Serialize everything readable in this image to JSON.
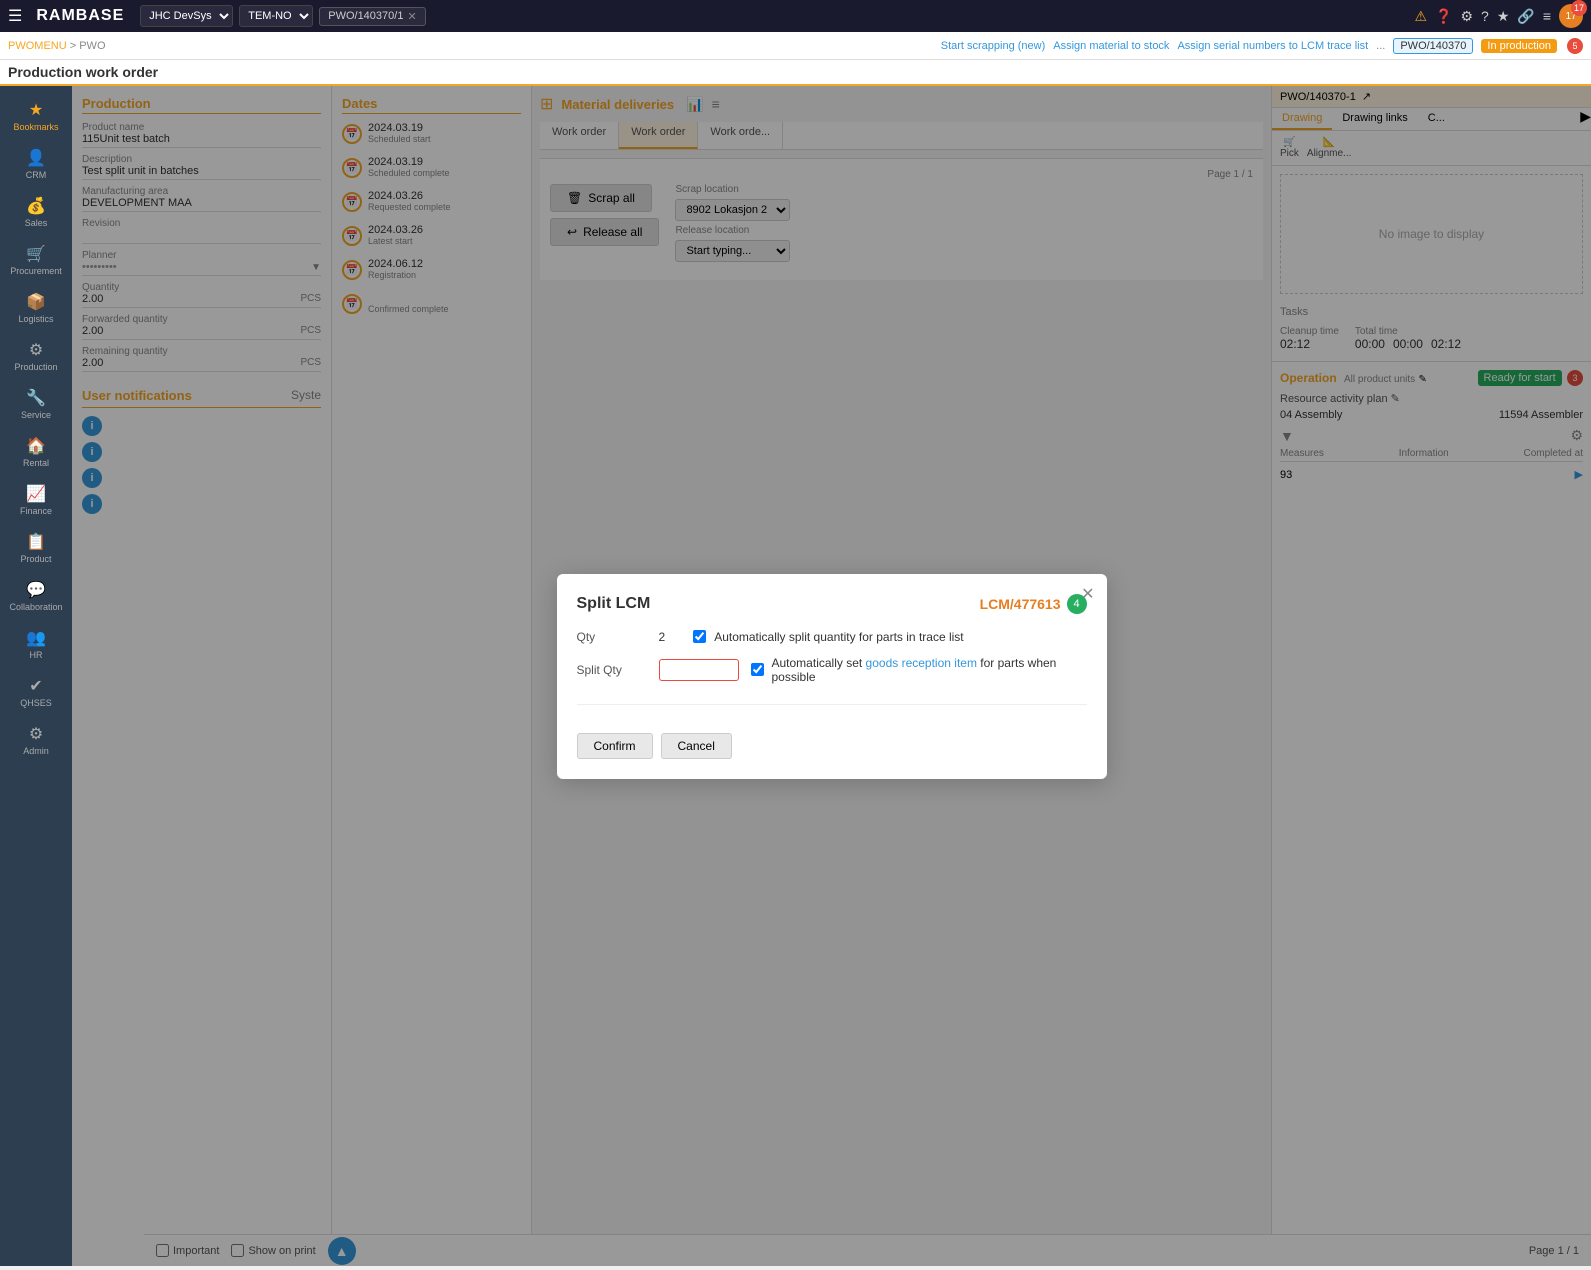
{
  "app": {
    "logo": "RAMBASE"
  },
  "topbar": {
    "hamburger": "☰",
    "company": "JHC DevSys",
    "env": "TEM-NO",
    "pwo_id": "PWO/140370/1",
    "alert_icon": "⚠",
    "help_icons": [
      "?",
      "★",
      "🔗",
      "≡"
    ],
    "user_number": "17"
  },
  "secondbar": {
    "breadcrumb_parent": "PWOMENU",
    "breadcrumb_separator": " > ",
    "breadcrumb_current": "PWO",
    "actions": {
      "start_scrapping": "Start scrapping (new)",
      "assign_material": "Assign material to stock",
      "assign_serial": "Assign serial numbers to LCM trace list",
      "more": "..."
    },
    "pwo_ref": "PWO/140370",
    "status": "In production",
    "status_count": "5"
  },
  "page_header": {
    "title": "Production work order"
  },
  "sidebar": {
    "items": [
      {
        "id": "bookmarks",
        "label": "Bookmarks",
        "icon": "★",
        "active": true
      },
      {
        "id": "crm",
        "label": "CRM",
        "icon": "👤"
      },
      {
        "id": "sales",
        "label": "Sales",
        "icon": "💰"
      },
      {
        "id": "procurement",
        "label": "Procurement",
        "icon": "🛒"
      },
      {
        "id": "logistics",
        "label": "Logistics",
        "icon": "📦"
      },
      {
        "id": "production",
        "label": "Production",
        "icon": "⚙"
      },
      {
        "id": "service",
        "label": "Service",
        "icon": "🔧"
      },
      {
        "id": "rental",
        "label": "Rental",
        "icon": "🏠"
      },
      {
        "id": "finance",
        "label": "Finance",
        "icon": "📈"
      },
      {
        "id": "product",
        "label": "Product",
        "icon": "📋"
      },
      {
        "id": "collaboration",
        "label": "Collaboration",
        "icon": "💬"
      },
      {
        "id": "hr",
        "label": "HR",
        "icon": "👥"
      },
      {
        "id": "qhses",
        "label": "QHSES",
        "icon": "✔"
      },
      {
        "id": "admin",
        "label": "Admin",
        "icon": "⚙"
      }
    ]
  },
  "production_section": {
    "title": "Production",
    "fields": {
      "product_name_label": "Product name",
      "product_name_value": "115Unit test batch",
      "description_label": "Description",
      "description_value": "Test split unit in batches",
      "manufacturing_area_label": "Manufacturing area",
      "manufacturing_area_value": "DEVELOPMENT MAA",
      "revision_label": "Revision",
      "revision_value": "",
      "planner_label": "Planner",
      "planner_value": "••• •••••",
      "quantity_label": "Quantity",
      "quantity_value": "2.00",
      "quantity_unit": "PCS",
      "forwarded_quantity_label": "Forwarded quantity",
      "forwarded_quantity_value": "2.00",
      "forwarded_quantity_unit": "PCS",
      "remaining_quantity_label": "Remaining quantity",
      "remaining_quantity_value": "2.00",
      "remaining_quantity_unit": "PCS"
    }
  },
  "dates_section": {
    "title": "Dates",
    "entries": [
      {
        "date": "2024.03.19",
        "label": "Scheduled start"
      },
      {
        "date": "2024.03.19",
        "label": "Scheduled complete"
      },
      {
        "date": "2024.03.26",
        "label": "Requested complete"
      },
      {
        "date": "2024.03.26",
        "label": "Latest start"
      },
      {
        "date": "2024.06.12",
        "label": "Registration"
      },
      {
        "date": "",
        "label": "Confirmed complete"
      }
    ]
  },
  "material_deliveries": {
    "title": "Material deliveries",
    "icon": "≡"
  },
  "user_notifications": {
    "title": "User notifications",
    "system_label": "Syste",
    "items": [
      {
        "type": "info"
      },
      {
        "type": "info"
      },
      {
        "type": "info"
      },
      {
        "type": "info"
      }
    ]
  },
  "right_panel": {
    "tabs": [
      {
        "id": "drawing",
        "label": "Drawing",
        "active": true
      },
      {
        "id": "drawing_links",
        "label": "Drawing links"
      },
      {
        "id": "c",
        "label": "C..."
      }
    ],
    "no_image_text": "No image to display",
    "actions": {
      "pick": "Pick",
      "alignme": "Alignme..."
    }
  },
  "operation": {
    "title": "Operation",
    "all_product_units": "All product units",
    "ready_for_start": "Ready for start",
    "ready_count": "3",
    "resource_activity_plan": "Resource activity plan",
    "assembly_code": "04 Assembly",
    "assembler_code": "11594 Assembler",
    "cleanup_time_label": "Cleanup time",
    "total_time_label": "Total time",
    "times": {
      "cleanup": "02:12",
      "total_zero1": "00:00",
      "total_zero2": "00:00",
      "total": "02:12"
    },
    "measures_label": "Measures",
    "information_label": "Information",
    "completed_at_label": "Completed at",
    "row_value": "93"
  },
  "scrap_section": {
    "scrap_all_label": "Scrap all",
    "release_all_label": "Release all",
    "scrap_location_label": "Scrap location",
    "scrap_location_value": "8902 Lokasjon 2",
    "release_location_label": "Release location",
    "release_location_placeholder": "Start typing..."
  },
  "pagination": {
    "page_info": "Page 1 / 1"
  },
  "bottom_bar": {
    "important_label": "Important",
    "show_on_print_label": "Show on print",
    "page_info": "Page 1 / 1"
  },
  "modal": {
    "title": "Split LCM",
    "lcm_id": "LCM/477613",
    "lcm_count": "4",
    "qty_label": "Qty",
    "qty_value": "2",
    "split_qty_label": "Split Qty",
    "split_qty_value": "",
    "auto_split_label": "Automatically split quantity for parts in trace list",
    "auto_goods_label": "Automatically set",
    "auto_goods_link": "goods reception item",
    "auto_goods_suffix": "for parts when possible",
    "confirm_label": "Confirm",
    "cancel_label": "Cancel"
  },
  "wo_tabs": [
    {
      "label": "Work order",
      "active": false
    },
    {
      "label": "Work order",
      "active": true
    },
    {
      "label": "Work orde...",
      "active": false
    }
  ],
  "colors": {
    "accent": "#f5a623",
    "primary": "#3498db",
    "success": "#27ae60",
    "danger": "#e74c3c",
    "sidebar_bg": "#2c3e50"
  }
}
